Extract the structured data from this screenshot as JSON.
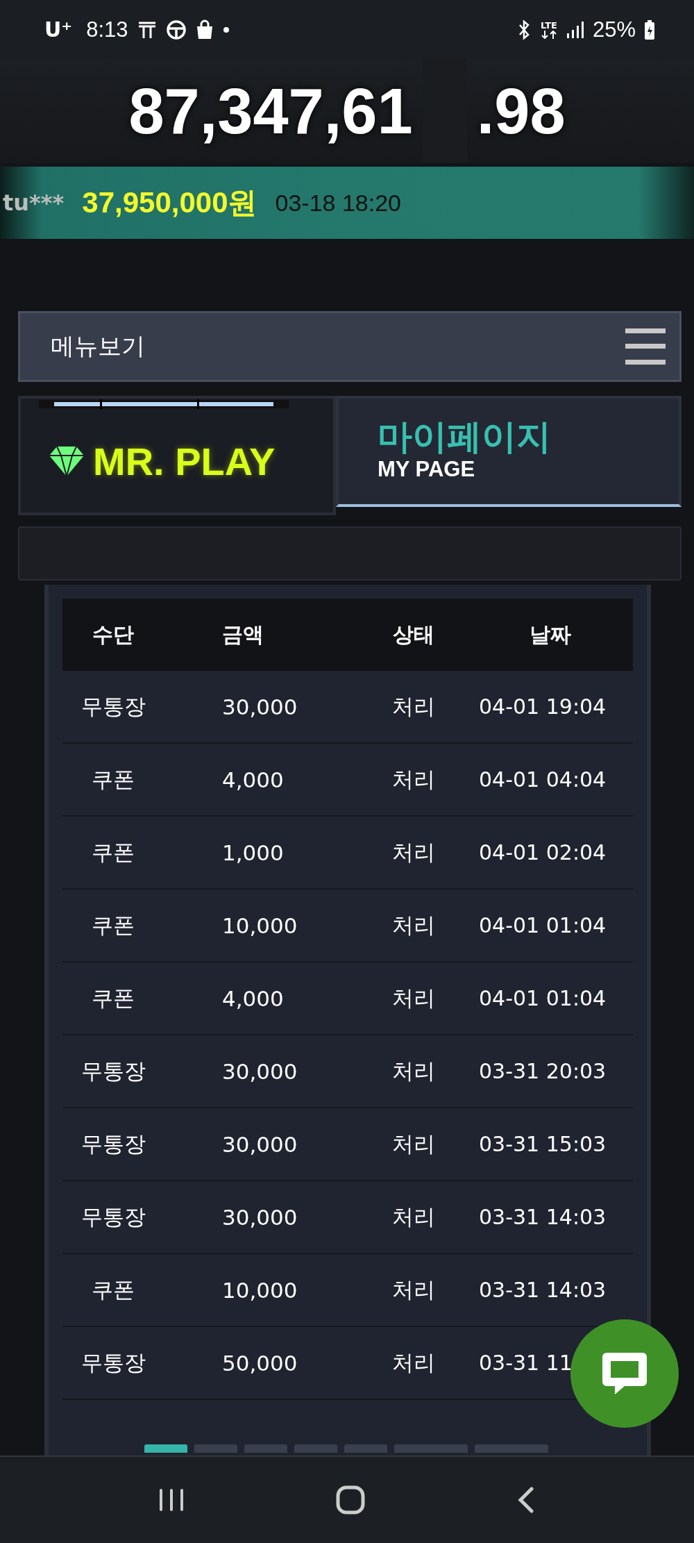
{
  "status_bar": {
    "carrier": "U⁺",
    "time": "8:13",
    "network": "LTE",
    "battery": "25%"
  },
  "jackpot": {
    "leading": "87,347,61",
    "trailing": ".98"
  },
  "winner_ticker": {
    "user": "tu***",
    "amount": "37,950,000원",
    "date": "03-18 18:20"
  },
  "menu_bar": {
    "label": "메뉴보기"
  },
  "header": {
    "logo": "MR. PLAY",
    "title": "마이페이지",
    "subtitle": "MY PAGE"
  },
  "table": {
    "columns": [
      "수단",
      "금액",
      "상태",
      "날짜"
    ],
    "rows": [
      [
        "무통장",
        "30,000",
        "처리",
        "04-01 19:04"
      ],
      [
        "쿠폰",
        "4,000",
        "처리",
        "04-01 04:04"
      ],
      [
        "쿠폰",
        "1,000",
        "처리",
        "04-01 02:04"
      ],
      [
        "쿠폰",
        "10,000",
        "처리",
        "04-01 01:04"
      ],
      [
        "쿠폰",
        "4,000",
        "처리",
        "04-01 01:04"
      ],
      [
        "무통장",
        "30,000",
        "처리",
        "03-31 20:03"
      ],
      [
        "무통장",
        "30,000",
        "처리",
        "03-31 15:03"
      ],
      [
        "무통장",
        "30,000",
        "처리",
        "03-31 14:03"
      ],
      [
        "쿠폰",
        "10,000",
        "처리",
        "03-31 14:03"
      ],
      [
        "무통장",
        "50,000",
        "처리",
        "03-31 11"
      ]
    ]
  },
  "pagination": [
    {
      "selected": true
    },
    {
      "selected": false
    },
    {
      "selected": false
    },
    {
      "selected": false
    },
    {
      "selected": false
    },
    {
      "selected": false
    },
    {
      "selected": false
    }
  ]
}
